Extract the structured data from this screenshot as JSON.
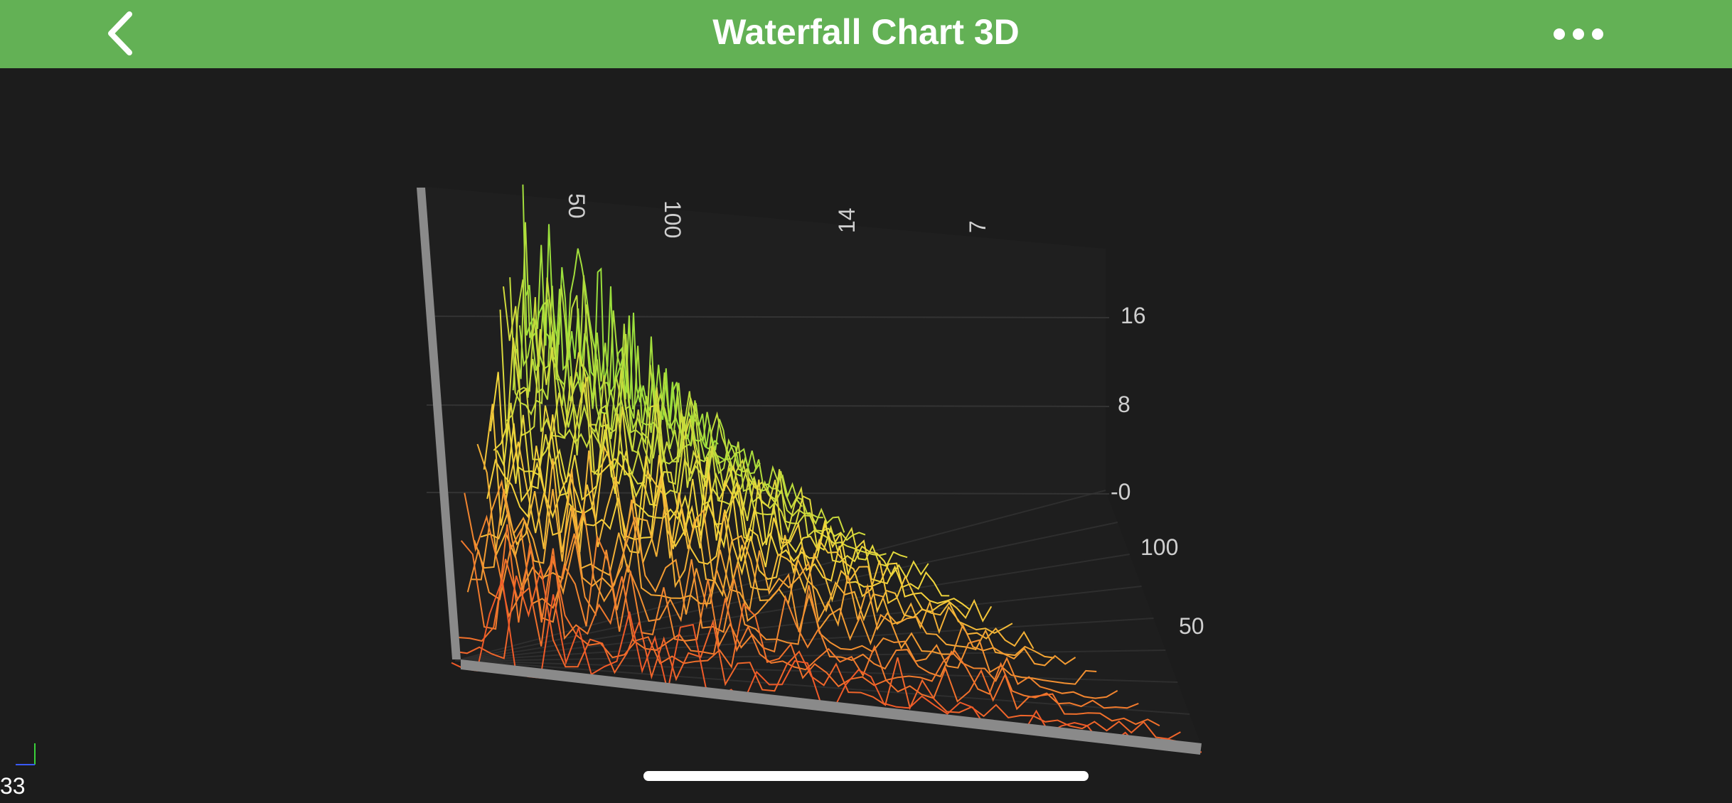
{
  "nav": {
    "title": "Waterfall Chart 3D",
    "back_icon": "chevron-left-icon",
    "more_icon": "ellipsis-icon"
  },
  "colors": {
    "nav_background": "#63b155",
    "background": "#1c1c1c",
    "series_front": "#f05a28",
    "series_mid": "#f5d63c",
    "series_back": "#9adf3c",
    "axis_frame": "#8a8a8a",
    "tick_label": "#cfcfcf"
  },
  "chart_data": {
    "type": "waterfall-3d",
    "x_tick_labels": [
      "50",
      "100"
    ],
    "z_tick_labels": [
      "14",
      "7"
    ],
    "y_tick_labels": [
      "16",
      "8",
      "-0"
    ],
    "depth_tick_labels": [
      "100",
      "50"
    ],
    "slices": 24,
    "points_per_slice": 60,
    "grid": true
  },
  "status": {
    "fps": "33"
  }
}
